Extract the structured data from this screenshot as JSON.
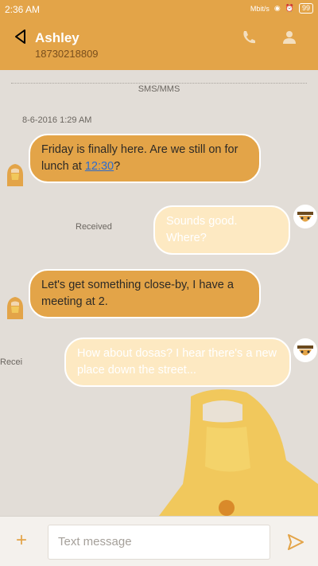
{
  "status_bar": {
    "time": "2:36 AM",
    "network": "Mbit/s",
    "battery": "99"
  },
  "header": {
    "contact_name": "Ashley",
    "phone_number": "18730218809"
  },
  "chat": {
    "separator_label": "SMS/MMS",
    "date": "8-6-2016 1:29 AM",
    "messages": [
      {
        "direction": "incoming",
        "text_before": "Friday is finally here. Are we still on for lunch at ",
        "link": "12:30",
        "text_after": "?"
      },
      {
        "direction": "outgoing",
        "text": "Sounds good. Where?",
        "status": "Received"
      },
      {
        "direction": "incoming",
        "text": "Let's get something close-by, I have a meeting at 2."
      },
      {
        "direction": "outgoing",
        "text": "How about dosas? I hear there's a new place down the street...",
        "status": "Recei"
      }
    ]
  },
  "composer": {
    "placeholder": "Text message"
  },
  "colors": {
    "accent": "#e3a448",
    "outgoing_bubble": "#fde9c2",
    "background": "#e2ddd7"
  },
  "icons": [
    "back-arrow-icon",
    "phone-icon",
    "contact-icon",
    "plus-icon",
    "send-icon"
  ]
}
